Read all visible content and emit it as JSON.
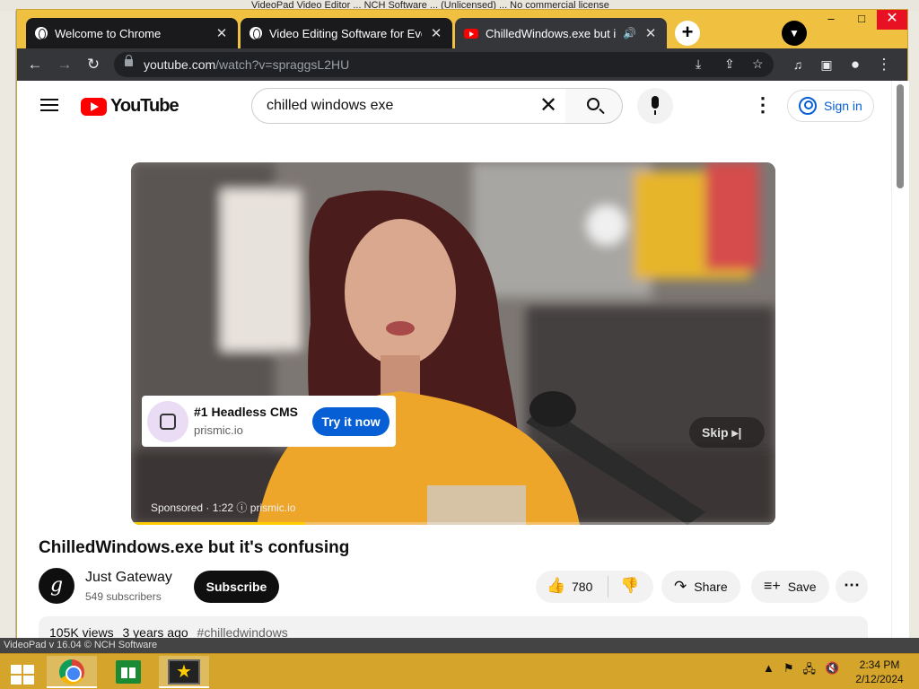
{
  "background_window": {
    "title_fragment": "VideoPad Video Editor ... NCH Software ... (Unlicensed) ... No commercial license",
    "status_text": "VideoPad v 16.04 © NCH Software"
  },
  "browser": {
    "tabs": [
      {
        "title": "Welcome to Chrome",
        "icon": "globe-icon"
      },
      {
        "title": "Video Editing Software for Everyone",
        "icon": "globe-icon"
      },
      {
        "title": "ChilledWindows.exe but it's confusing",
        "icon": "youtube-icon",
        "audio": "speaker-icon"
      }
    ],
    "new_tab_label": "+",
    "url_host": "youtube.com",
    "url_path": "/watch?v=spraggsL2HU",
    "window_controls": {
      "minimize": "–",
      "maximize": "□",
      "close": "✕"
    }
  },
  "youtube": {
    "logo_text": "YouTube",
    "search_value": "chilled windows exe",
    "sign_in": "Sign in"
  },
  "ad": {
    "title": "#1 Headless CMS",
    "domain": "prismic.io",
    "cta": "Try it now",
    "skip": "Skip ▸|",
    "sponsored_prefix": "Sponsored · 1:22",
    "sponsored_domain": "prismic.io",
    "info_glyph": "ⓘ",
    "progress_fraction": 0.27
  },
  "video": {
    "title": "ChilledWindows.exe but it's confusing",
    "channel": "Just Gateway",
    "channel_initial": "g",
    "subscribers": "549 subscribers",
    "subscribe_label": "Subscribe",
    "likes": "780",
    "share_label": "Share",
    "save_label": "Save",
    "views": "105K views",
    "age": "3 years ago",
    "hashtag": "#chilledwindows"
  },
  "taskbar": {
    "time": "2:34 PM",
    "date": "2/12/2024"
  },
  "colors": {
    "accent_window": "#f0c040",
    "youtube_red": "#ff0000",
    "link_blue": "#065fd4"
  }
}
